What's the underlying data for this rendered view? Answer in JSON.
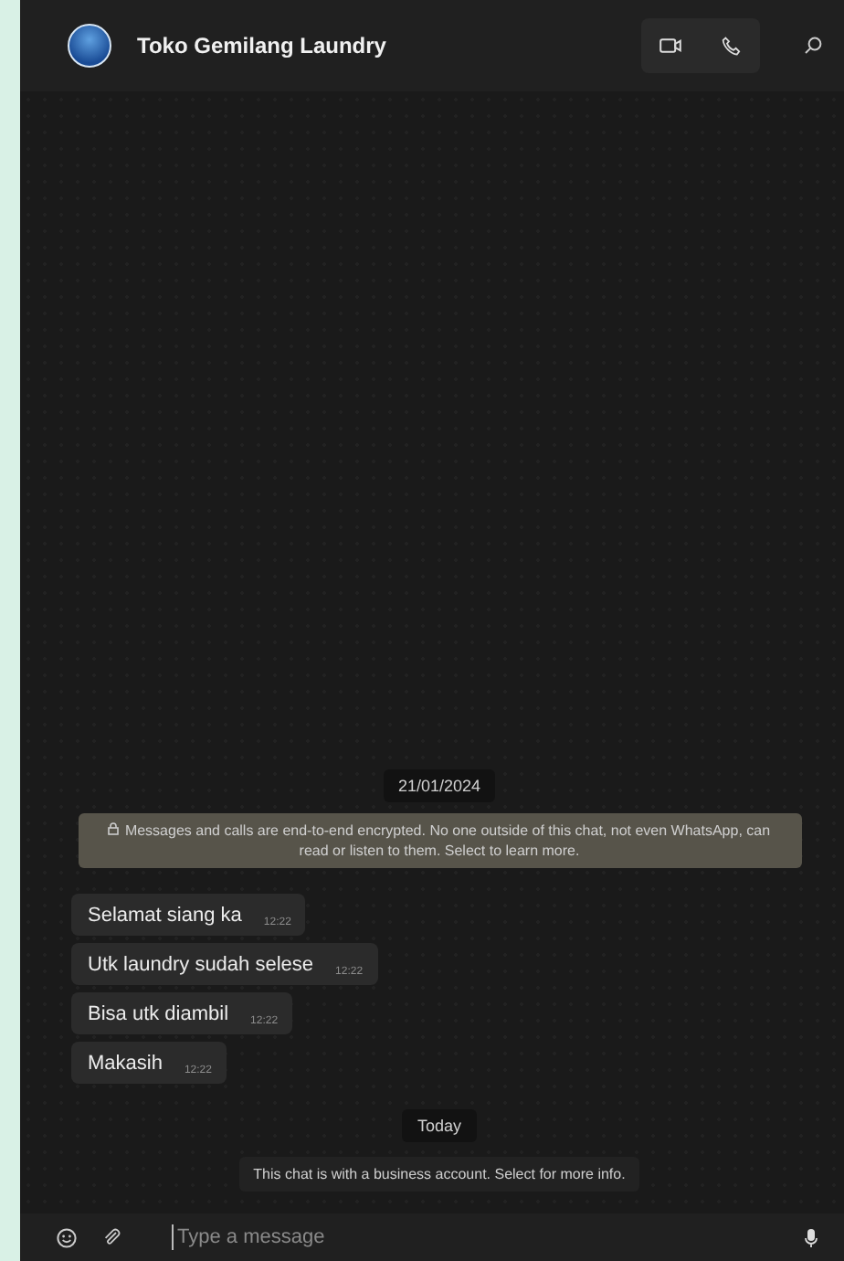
{
  "header": {
    "title": "Toko Gemilang Laundry"
  },
  "chat": {
    "date_divider": "21/01/2024",
    "encryption_notice": "Messages and calls are end-to-end encrypted. No one outside of this chat, not even WhatsApp, can read or listen to them. Select to learn more.",
    "messages": [
      {
        "text": "Selamat siang ka",
        "time": "12:22"
      },
      {
        "text": "Utk laundry sudah selese",
        "time": "12:22"
      },
      {
        "text": "Bisa utk diambil",
        "time": "12:22"
      },
      {
        "text": "Makasih",
        "time": "12:22"
      }
    ],
    "today_divider": "Today",
    "business_notice": "This chat is with a business account. Select for more info."
  },
  "composer": {
    "placeholder": "Type a message"
  }
}
